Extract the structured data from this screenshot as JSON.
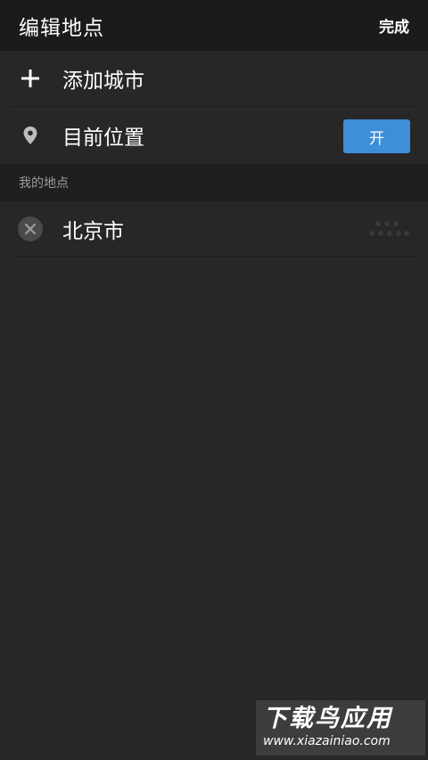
{
  "header": {
    "title": "编辑地点",
    "done_label": "完成"
  },
  "rows": {
    "add_city": {
      "label": "添加城市",
      "icon": "plus-icon"
    },
    "current_location": {
      "label": "目前位置",
      "icon": "map-pin-icon",
      "toggle_label": "开",
      "toggle_on": true
    }
  },
  "section": {
    "title": "我的地点"
  },
  "places": [
    {
      "label": "北京市",
      "remove_icon": "close-circle-icon",
      "handle_icon": "drag-handle-icon"
    }
  ],
  "watermark": {
    "brand": "下载鸟应用",
    "url": "www.xiazainiao.com"
  },
  "colors": {
    "background": "#272727",
    "header_background": "#1b1b1b",
    "section_background": "#1f1f1f",
    "accent": "#3d8fd8"
  }
}
